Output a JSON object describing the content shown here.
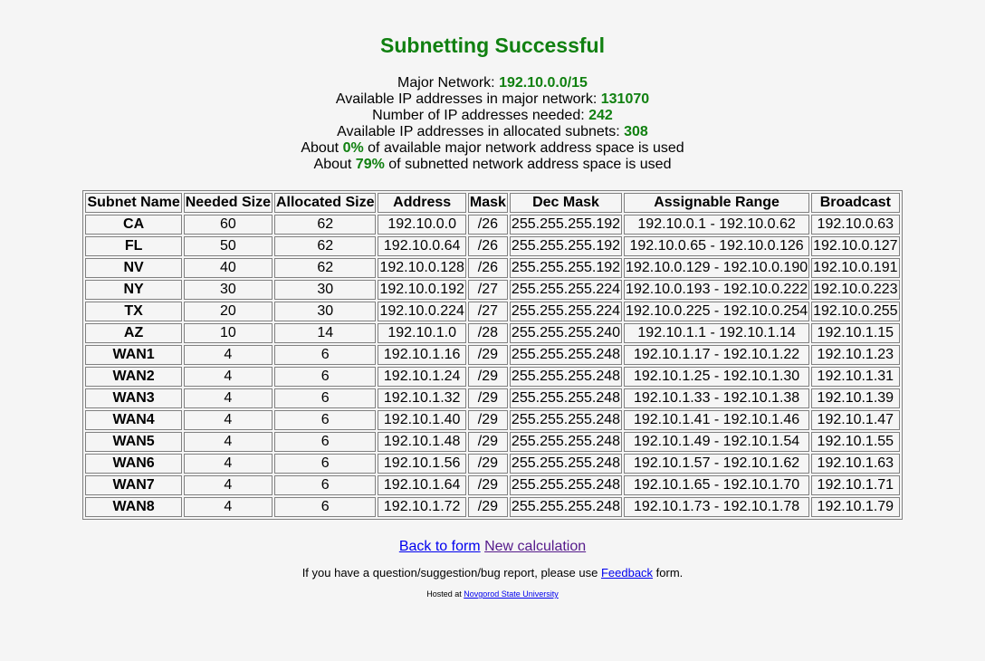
{
  "title": "Subnetting Successful",
  "summary": [
    {
      "prefix": "Major Network: ",
      "value": "192.10.0.0/15",
      "suffix": ""
    },
    {
      "prefix": "Available IP addresses in major network: ",
      "value": "131070",
      "suffix": ""
    },
    {
      "prefix": "Number of IP addresses needed: ",
      "value": "242",
      "suffix": ""
    },
    {
      "prefix": "Available IP addresses in allocated subnets: ",
      "value": "308",
      "suffix": ""
    },
    {
      "prefix": "About ",
      "value": "0%",
      "suffix": " of available major network address space is used"
    },
    {
      "prefix": "About ",
      "value": "79%",
      "suffix": " of subnetted network address space is used"
    }
  ],
  "table": {
    "headers": [
      "Subnet Name",
      "Needed Size",
      "Allocated Size",
      "Address",
      "Mask",
      "Dec Mask",
      "Assignable Range",
      "Broadcast"
    ],
    "rows": [
      [
        "CA",
        "60",
        "62",
        "192.10.0.0",
        "/26",
        "255.255.255.192",
        "192.10.0.1 - 192.10.0.62",
        "192.10.0.63"
      ],
      [
        "FL",
        "50",
        "62",
        "192.10.0.64",
        "/26",
        "255.255.255.192",
        "192.10.0.65 - 192.10.0.126",
        "192.10.0.127"
      ],
      [
        "NV",
        "40",
        "62",
        "192.10.0.128",
        "/26",
        "255.255.255.192",
        "192.10.0.129 - 192.10.0.190",
        "192.10.0.191"
      ],
      [
        "NY",
        "30",
        "30",
        "192.10.0.192",
        "/27",
        "255.255.255.224",
        "192.10.0.193 - 192.10.0.222",
        "192.10.0.223"
      ],
      [
        "TX",
        "20",
        "30",
        "192.10.0.224",
        "/27",
        "255.255.255.224",
        "192.10.0.225 - 192.10.0.254",
        "192.10.0.255"
      ],
      [
        "AZ",
        "10",
        "14",
        "192.10.1.0",
        "/28",
        "255.255.255.240",
        "192.10.1.1 - 192.10.1.14",
        "192.10.1.15"
      ],
      [
        "WAN1",
        "4",
        "6",
        "192.10.1.16",
        "/29",
        "255.255.255.248",
        "192.10.1.17 - 192.10.1.22",
        "192.10.1.23"
      ],
      [
        "WAN2",
        "4",
        "6",
        "192.10.1.24",
        "/29",
        "255.255.255.248",
        "192.10.1.25 - 192.10.1.30",
        "192.10.1.31"
      ],
      [
        "WAN3",
        "4",
        "6",
        "192.10.1.32",
        "/29",
        "255.255.255.248",
        "192.10.1.33 - 192.10.1.38",
        "192.10.1.39"
      ],
      [
        "WAN4",
        "4",
        "6",
        "192.10.1.40",
        "/29",
        "255.255.255.248",
        "192.10.1.41 - 192.10.1.46",
        "192.10.1.47"
      ],
      [
        "WAN5",
        "4",
        "6",
        "192.10.1.48",
        "/29",
        "255.255.255.248",
        "192.10.1.49 - 192.10.1.54",
        "192.10.1.55"
      ],
      [
        "WAN6",
        "4",
        "6",
        "192.10.1.56",
        "/29",
        "255.255.255.248",
        "192.10.1.57 - 192.10.1.62",
        "192.10.1.63"
      ],
      [
        "WAN7",
        "4",
        "6",
        "192.10.1.64",
        "/29",
        "255.255.255.248",
        "192.10.1.65 - 192.10.1.70",
        "192.10.1.71"
      ],
      [
        "WAN8",
        "4",
        "6",
        "192.10.1.72",
        "/29",
        "255.255.255.248",
        "192.10.1.73 - 192.10.1.78",
        "192.10.1.79"
      ]
    ]
  },
  "links": {
    "back": "Back to form",
    "new_calc": "New calculation"
  },
  "feedback": {
    "before": "If you have a question/suggestion/bug report, please use ",
    "link": "Feedback",
    "after": " form."
  },
  "hosted": {
    "before": "Hosted at ",
    "link": "Novgorod State University"
  },
  "colors": {
    "accent_green": "#108010",
    "link": "#0000ee",
    "visited_link": "#551a8b",
    "background": "#f5f5f5"
  }
}
